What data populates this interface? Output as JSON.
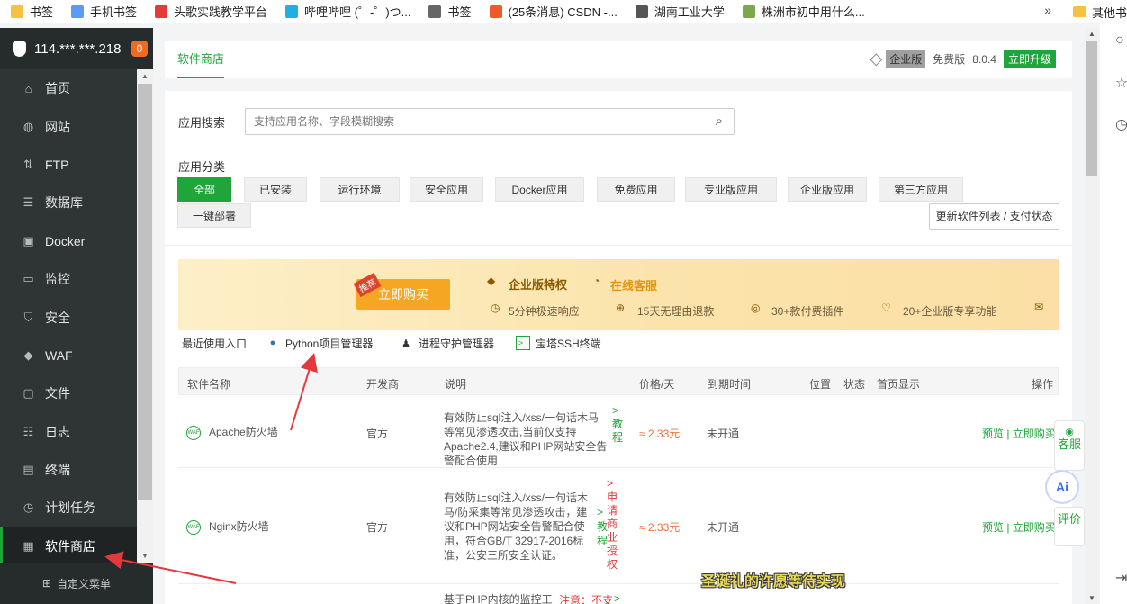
{
  "bookmarks": {
    "items": [
      {
        "label": "书签",
        "icon": "star-icon",
        "color": "#f5c242"
      },
      {
        "label": "手机书签",
        "icon": "phone-icon",
        "color": "#5b9bf5"
      },
      {
        "label": "头歌实践教学平台",
        "icon": "toutiao-logo-icon",
        "color": "#e43b3b"
      },
      {
        "label": "哔哩哔哩 (゜-゜)つ...",
        "icon": "bilibili-icon",
        "color": "#23ade5"
      },
      {
        "label": "书签",
        "icon": "star-outline-icon",
        "color": "#666666"
      },
      {
        "label": "(25条消息) CSDN -...",
        "icon": "csdn-icon",
        "color": "#f05a28"
      },
      {
        "label": "湖南工业大学",
        "icon": "globe-icon",
        "color": "#555555"
      },
      {
        "label": "株洲市初中用什么...",
        "icon": "book-icon",
        "color": "#7aa84b"
      }
    ],
    "more": "»",
    "other": "其他书"
  },
  "sidebar": {
    "server_ip": "114.***.***.218",
    "badge": "0",
    "items": [
      {
        "label": "首页",
        "icon": "home-icon"
      },
      {
        "label": "网站",
        "icon": "globe-icon"
      },
      {
        "label": "FTP",
        "icon": "ftp-icon"
      },
      {
        "label": "数据库",
        "icon": "database-icon"
      },
      {
        "label": "Docker",
        "icon": "docker-icon"
      },
      {
        "label": "监控",
        "icon": "monitor-icon"
      },
      {
        "label": "安全",
        "icon": "shield-icon"
      },
      {
        "label": "WAF",
        "icon": "waf-shield-icon"
      },
      {
        "label": "文件",
        "icon": "folder-icon"
      },
      {
        "label": "日志",
        "icon": "log-icon"
      },
      {
        "label": "终端",
        "icon": "terminal-icon"
      },
      {
        "label": "计划任务",
        "icon": "clock-icon"
      },
      {
        "label": "软件商店",
        "icon": "apps-grid-icon"
      }
    ],
    "active_index": 12,
    "footer": "自定义菜单"
  },
  "header": {
    "tab": "软件商店",
    "edition_label": "企业版",
    "free_label": "免费版",
    "version": "8.0.4",
    "upgrade": "立即升级"
  },
  "search": {
    "label": "应用搜索",
    "placeholder": "支持应用名称、字段模糊搜索"
  },
  "categories": {
    "label": "应用分类",
    "items": [
      "全部",
      "已安装",
      "运行环境",
      "安全应用",
      "Docker应用",
      "免费应用",
      "专业版应用",
      "企业版应用",
      "第三方应用",
      "一键部署"
    ],
    "active_index": 0,
    "refresh": "更新软件列表 / 支付状态"
  },
  "banner": {
    "tag": "推荐",
    "buy": "立即购买",
    "title": "企业版特权",
    "service": "在线客服",
    "features": [
      "5分钟极速响应",
      "15天无理由退款",
      "30+款付费插件",
      "20+企业版专享功能"
    ]
  },
  "recent": {
    "label": "最近使用入口",
    "items": [
      {
        "label": "Python项目管理器",
        "icon": "python-icon"
      },
      {
        "label": "进程守护管理器",
        "icon": "penguin-icon"
      },
      {
        "label": "宝塔SSH终端",
        "icon": "terminal-icon"
      }
    ]
  },
  "table": {
    "headers": [
      "软件名称",
      "开发商",
      "说明",
      "价格/天",
      "到期时间",
      "位置",
      "状态",
      "首页显示",
      "操作"
    ],
    "rows": [
      {
        "name": "Apache防火墙",
        "vendor": "官方",
        "desc": "有效防止sql注入/xss/一句话木马等常见渗透攻击,当前仅支持Apache2.4,建议和PHP网站安全告警配合使用",
        "link": ">教程",
        "price": "≈ 2.33元",
        "expire": "未开通",
        "ops": "预览 | 立即购买"
      },
      {
        "name": "Nginx防火墙",
        "vendor": "官方",
        "desc": "有效防止sql注入/xss/一句话木马/防采集等常见渗透攻击，建议和PHP网站安全告警配合使用，符合GB/T 32917-2016标准，公安三所安全认证。",
        "link_red": ">申请商业授权",
        "link": ">教程",
        "price": "≈ 2.33元",
        "expire": "未开通",
        "ops": "预览 | 立即购买"
      },
      {
        "desc": "基于PHP内核的监控工",
        "note": "注意：不支",
        "link": ">"
      }
    ]
  },
  "floating": {
    "kefu": "客服",
    "ai": "Ai",
    "rate": "评价"
  },
  "overlay": "圣诞礼的许愿等待实现",
  "colors": {
    "brand_green": "#20a53a",
    "sidebar_bg": "#2f3435",
    "price_orange": "#f0703a",
    "annotation_red": "#e4393c"
  }
}
